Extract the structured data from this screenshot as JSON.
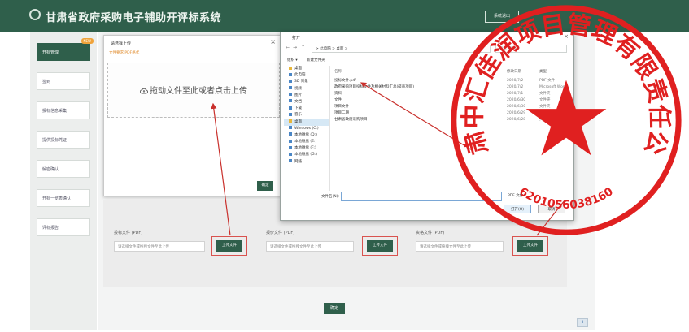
{
  "header": {
    "title": "甘肃省政府采购电子辅助开评标系统",
    "button_label": "系统退出"
  },
  "sidebar": {
    "items": [
      {
        "label": "开标管理",
        "badge": "NEW",
        "active": true
      },
      {
        "label": "签到",
        "active": false
      },
      {
        "label": "投标信息采集",
        "active": false
      },
      {
        "label": "提供投标凭证",
        "active": false
      },
      {
        "label": "解密确认",
        "active": false
      },
      {
        "label": "开标一览表确认",
        "active": false
      },
      {
        "label": "评标报告",
        "active": false
      }
    ]
  },
  "upload_dialog": {
    "title": "请选择上传",
    "hint": "文件要求 PDF格式",
    "dropzone_text": "拖动文件至此或者点击上传",
    "ok_label": "确定",
    "close_glyph": "×"
  },
  "file_dialog": {
    "title": "打开",
    "close_glyph": "×",
    "address": "> 此电脑 > 桌面 >",
    "search_placeholder": "搜索\"桌面\"",
    "toolbar": {
      "organize": "组织 ▾",
      "new_folder": "新建文件夹"
    },
    "columns": {
      "name": "名称",
      "date": "修改日期",
      "type": "类型"
    },
    "nav_items": [
      {
        "label": "桌面",
        "icon": "folder",
        "selected": false
      },
      {
        "label": "此电脑",
        "icon": "pc",
        "selected": false
      },
      {
        "label": "3D 对象",
        "icon": "drive",
        "selected": false
      },
      {
        "label": "视频",
        "icon": "drive",
        "selected": false
      },
      {
        "label": "图片",
        "icon": "drive",
        "selected": false
      },
      {
        "label": "文档",
        "icon": "drive",
        "selected": false
      },
      {
        "label": "下载",
        "icon": "drive",
        "selected": false
      },
      {
        "label": "音乐",
        "icon": "drive",
        "selected": false
      },
      {
        "label": "桌面",
        "icon": "folder",
        "selected": true
      },
      {
        "label": "Windows (C:)",
        "icon": "drive",
        "selected": false
      },
      {
        "label": "本地磁盘 (D:)",
        "icon": "drive",
        "selected": false
      },
      {
        "label": "本地磁盘 (E:)",
        "icon": "drive",
        "selected": false
      },
      {
        "label": "本地磁盘 (F:)",
        "icon": "drive",
        "selected": false
      },
      {
        "label": "本地磁盘 (G:)",
        "icon": "drive",
        "selected": false
      },
      {
        "label": "网络",
        "icon": "drive",
        "selected": false
      }
    ],
    "files": [
      {
        "name": "投标文件.pdf",
        "date": "2020/7/2",
        "type": "PDF 文件"
      },
      {
        "name": "政府采购项目投标文件及相关材料汇总(磋商项目)",
        "date": "2020/7/2",
        "type": "Microsoft Word"
      },
      {
        "name": "资料",
        "date": "2020/7/1",
        "type": "文件夹"
      },
      {
        "name": "文件",
        "date": "2020/6/30",
        "type": "文件夹"
      },
      {
        "name": "项目文件",
        "date": "2020/6/30",
        "type": "文件夹"
      },
      {
        "name": "项目二期",
        "date": "2020/6/29",
        "type": "文件夹"
      },
      {
        "name": "甘肃省政府采购项目",
        "date": "2020/6/28",
        "type": "文件夹"
      }
    ],
    "filename_label": "文件名(N):",
    "filetype_label": "PDF 文件",
    "open_label": "打开(O)",
    "cancel_label": "取消"
  },
  "upload_sections": [
    {
      "label": "投标文件 (PDF)",
      "placeholder": "请选择文件或拖拽文件至此上传",
      "button": "上传文件"
    },
    {
      "label": "报价文件 (PDF)",
      "placeholder": "请选择文件或拖拽文件至此上传",
      "button": "上传文件"
    },
    {
      "label": "资格文件 (PDF)",
      "placeholder": "请选择文件或拖拽文件至此上传",
      "button": "上传文件"
    }
  ],
  "confirm_label": "确定",
  "stamp": {
    "text": "甘肃中汇佳润项目管理有限责任公司",
    "number": "6201056038160",
    "color": "#e02020"
  },
  "colors": {
    "brand": "#2f5f4b",
    "annotation": "#d9534f"
  }
}
